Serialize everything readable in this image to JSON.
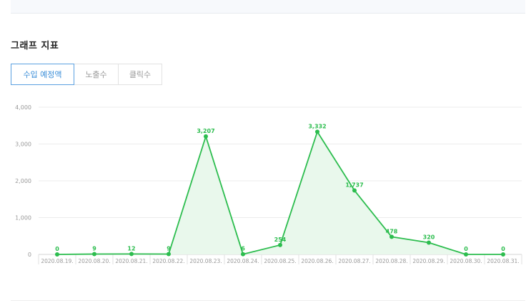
{
  "section": {
    "title": "그래프 지표"
  },
  "tabs": [
    {
      "label": "수입 예정액",
      "active": true
    },
    {
      "label": "노출수",
      "active": false
    },
    {
      "label": "클릭수",
      "active": false
    }
  ],
  "colors": {
    "line": "#2cbd4e",
    "fill": "#e9f8ec",
    "grid": "#ececec",
    "axis_text": "#999999",
    "tab_active": "#3b8ed8"
  },
  "chart_data": {
    "type": "area",
    "title": "",
    "xlabel": "",
    "ylabel": "",
    "ylim": [
      0,
      4000
    ],
    "yticks": [
      0,
      1000,
      2000,
      3000,
      4000
    ],
    "ytick_labels": [
      "0",
      "1,000",
      "2,000",
      "3,000",
      "4,000"
    ],
    "categories": [
      "2020.08.19.",
      "2020.08.20.",
      "2020.08.21.",
      "2020.08.22.",
      "2020.08.23.",
      "2020.08.24.",
      "2020.08.25.",
      "2020.08.26.",
      "2020.08.27.",
      "2020.08.28.",
      "2020.08.29.",
      "2020.08.30.",
      "2020.08.31."
    ],
    "series": [
      {
        "values": [
          0,
          9,
          12,
          9,
          3207,
          6,
          254,
          3332,
          1737,
          478,
          320,
          0,
          0
        ],
        "labels": [
          "0",
          "9",
          "12",
          "9",
          "3,207",
          "6",
          "254",
          "3,332",
          "1,737",
          "478",
          "320",
          "0",
          "0"
        ]
      }
    ],
    "grid": true,
    "legend": "none"
  }
}
